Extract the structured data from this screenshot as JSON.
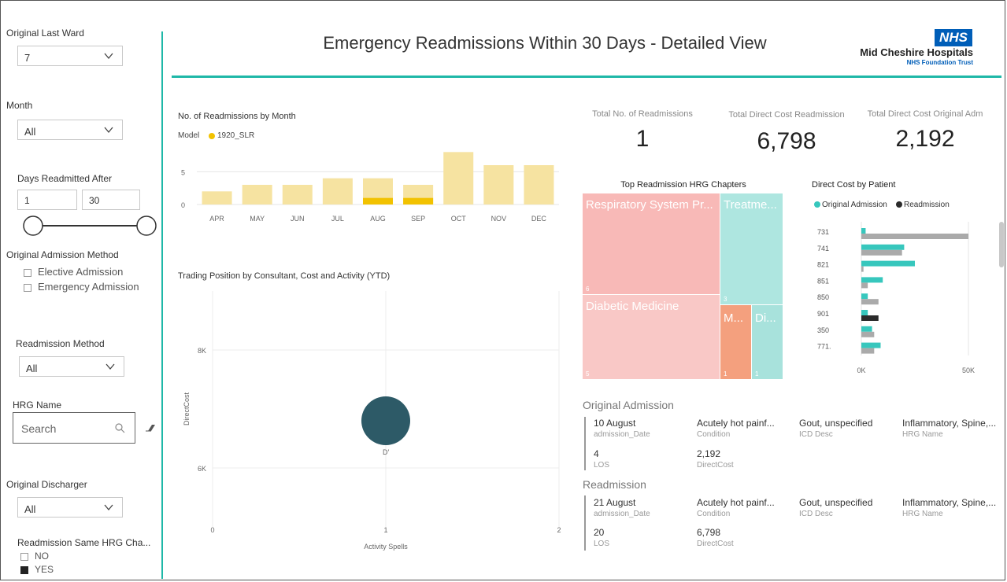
{
  "header": {
    "title": "Emergency Readmissions Within 30 Days - Detailed View",
    "logo": {
      "badge": "NHS",
      "org": "Mid Cheshire Hospitals",
      "sub": "NHS Foundation Trust"
    }
  },
  "colors": {
    "accent": "#1fb8a8",
    "bar_light": "#f6e3a1",
    "bar_dark": "#f2c200",
    "nhs_blue": "#005eb8",
    "teal": "#37c7bd",
    "gray": "#aaaaaa",
    "dark": "#2b2b2b",
    "bubble": "#2d5a67"
  },
  "filters": {
    "original_last_ward": {
      "label": "Original Last Ward",
      "value": "7"
    },
    "month": {
      "label": "Month",
      "value": "All"
    },
    "days_readmitted_after": {
      "label": "Days Readmitted After",
      "min": "1",
      "max": "30"
    },
    "original_admission_method": {
      "label": "Original Admission Method",
      "options": [
        "Elective Admission",
        "Emergency Admission"
      ]
    },
    "readmission_method": {
      "label": "Readmission Method",
      "value": "All"
    },
    "hrg_name": {
      "label": "HRG Name",
      "placeholder": "Search",
      "search_icon": "search-icon",
      "eraser_icon": "eraser-icon"
    },
    "original_discharger": {
      "label": "Original Discharger",
      "value": "All"
    },
    "readmission_same_hrg": {
      "label": "Readmission Same HRG Cha...",
      "options": [
        {
          "label": "NO",
          "checked": false
        },
        {
          "label": "YES",
          "checked": true
        }
      ]
    }
  },
  "kpis": [
    {
      "title": "Total No. of Readmissions",
      "value": "1"
    },
    {
      "title": "Total Direct Cost Readmission",
      "value": "6,798"
    },
    {
      "title": "Total Direct Cost Original Adm",
      "value": "2,192"
    }
  ],
  "monthly_chart": {
    "title": "No. of Readmissions by Month",
    "legend_label": "Model",
    "legend_item": "1920_SLR",
    "y_ticks": [
      "5",
      "0"
    ]
  },
  "trading_chart": {
    "title": "Trading Position by Consultant, Cost and Activity (YTD)",
    "x_label": "Activity Spells",
    "y_label": "DirectCost",
    "y_ticks": [
      "8K",
      "6K"
    ],
    "x_ticks": [
      "0",
      "1",
      "2"
    ],
    "bubble_label": "D'"
  },
  "treemap": {
    "title": "Top Readmission HRG Chapters",
    "tiles": [
      {
        "label": "Respiratory System Pr...",
        "count": "6",
        "color": "#f8b9b7"
      },
      {
        "label": "Treatme...",
        "count": "3",
        "color": "#aee6e0"
      },
      {
        "label": "Diabetic Medicine",
        "count": "5",
        "color": "#f9c8c6"
      },
      {
        "label": "M...",
        "count": "1",
        "color": "#f4a07e"
      },
      {
        "label": "Di...",
        "count": "1",
        "color": "#a8e2dc"
      }
    ]
  },
  "patient_chart": {
    "title": "Direct Cost by Patient",
    "legend": [
      "Original Admission",
      "Readmission"
    ],
    "x_ticks": [
      "0K",
      "50K"
    ]
  },
  "chart_data": [
    {
      "type": "bar",
      "title": "No. of Readmissions by Month",
      "categories": [
        "APR",
        "MAY",
        "JUN",
        "JUL",
        "AUG",
        "SEP",
        "OCT",
        "NOV",
        "DEC"
      ],
      "series": [
        {
          "name": "Model",
          "values": [
            2,
            3,
            3,
            4,
            4,
            3,
            8,
            6,
            6
          ]
        },
        {
          "name": "1920_SLR",
          "values": [
            0,
            0,
            0,
            0,
            1,
            1,
            0,
            0,
            0
          ]
        }
      ],
      "ylim": [
        0,
        9
      ]
    },
    {
      "type": "scatter",
      "title": "Trading Position by Consultant, Cost and Activity (YTD)",
      "xlabel": "Activity Spells",
      "ylabel": "DirectCost",
      "xlim": [
        0,
        2
      ],
      "ylim": [
        5000,
        9000
      ],
      "points": [
        {
          "label": "D'",
          "x": 1,
          "y": 6800
        }
      ]
    },
    {
      "type": "bar",
      "title": "Direct Cost by Patient",
      "orientation": "horizontal",
      "categories": [
        "731",
        "741",
        "821",
        "851",
        "850",
        "901",
        "350",
        "771."
      ],
      "series": [
        {
          "name": "Original Admission",
          "values": [
            2000,
            20000,
            25000,
            10000,
            3000,
            3000,
            5000,
            9000
          ]
        },
        {
          "name": "Readmission",
          "values": [
            50000,
            19000,
            1000,
            3000,
            8000,
            8000,
            6000,
            6000
          ]
        }
      ],
      "xlim": [
        0,
        60000
      ]
    }
  ],
  "original_admission": {
    "heading": "Original Admission",
    "row1": [
      {
        "value": "10 August",
        "label": "admission_Date"
      },
      {
        "value": "Acutely hot painf...",
        "label": "Condition"
      },
      {
        "value": "Gout, unspecified",
        "label": "ICD Desc"
      },
      {
        "value": "Inflammatory, Spine,...",
        "label": "HRG Name"
      }
    ],
    "row2": [
      {
        "value": "4",
        "label": "LOS"
      },
      {
        "value": "2,192",
        "label": "DirectCost"
      }
    ]
  },
  "readmission": {
    "heading": "Readmission",
    "row1": [
      {
        "value": "21 August",
        "label": "admission_Date"
      },
      {
        "value": "Acutely hot painf...",
        "label": "Condition"
      },
      {
        "value": "Gout, unspecified",
        "label": "ICD Desc"
      },
      {
        "value": "Inflammatory, Spine,...",
        "label": "HRG Name"
      }
    ],
    "row2": [
      {
        "value": "20",
        "label": "LOS"
      },
      {
        "value": "6,798",
        "label": "DirectCost"
      }
    ]
  }
}
